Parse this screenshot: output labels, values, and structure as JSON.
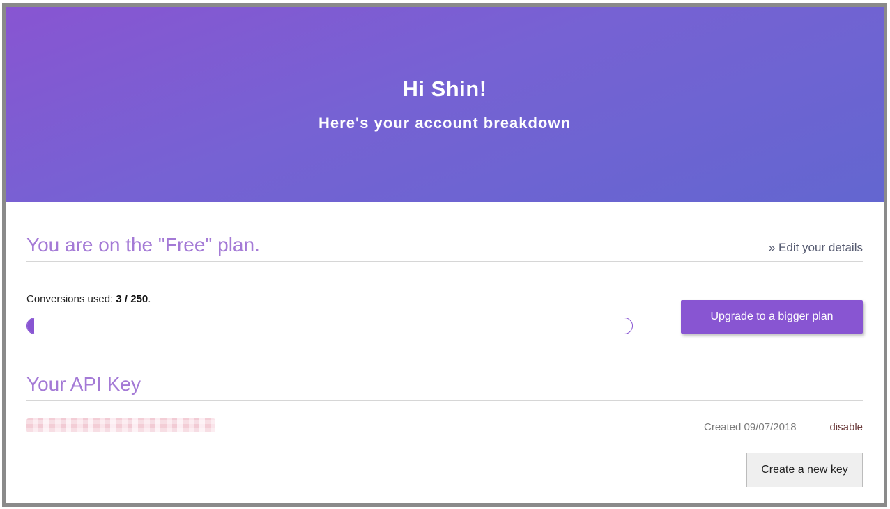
{
  "hero": {
    "title": "Hi Shin!",
    "subtitle": "Here's your account breakdown",
    "gradient_start": "#8855d2",
    "gradient_end": "#6366d0"
  },
  "plan": {
    "heading": "You are on the \"Free\" plan.",
    "edit_link": "» Edit your details",
    "conversions_label": "Conversions used: ",
    "conversions_value": "3 / 250",
    "conversions_suffix": ".",
    "used": 3,
    "limit": 250,
    "progress_fraction": 0.012,
    "upgrade_button": "Upgrade to a bigger plan"
  },
  "api": {
    "heading": "Your API Key",
    "key": "••••••••••••••••••••••••••••••••",
    "created": "Created 09/07/2018",
    "disable_link": "disable",
    "new_key_button": "Create a new key"
  },
  "colors": {
    "accent": "#8855d2",
    "heading": "#a47ad6"
  }
}
